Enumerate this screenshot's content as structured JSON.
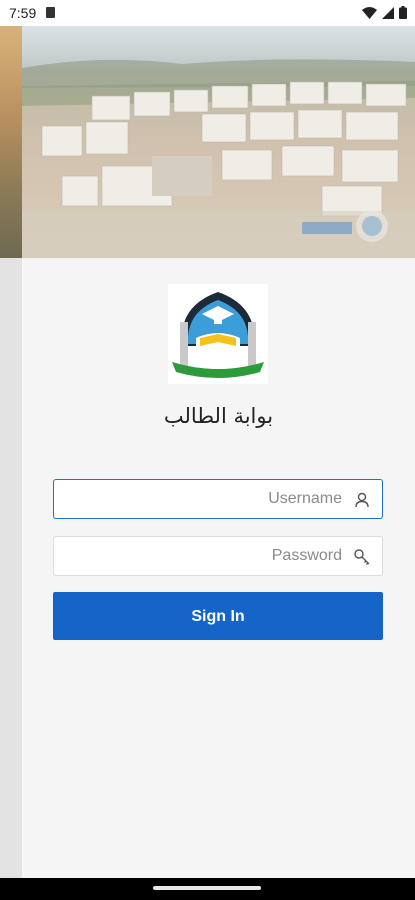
{
  "status_bar": {
    "time": "7:59",
    "icons": [
      "sd-card-icon",
      "wifi-icon",
      "signal-icon",
      "battery-icon"
    ]
  },
  "header": {
    "image": "campus-aerial-photo"
  },
  "logo": {
    "icon": "university-emblem"
  },
  "portal_title": "بوابة الطالب",
  "form": {
    "username_placeholder": "Username",
    "password_placeholder": "Password",
    "signin_label": "Sign In",
    "username_icon": "user-icon",
    "password_icon": "key-icon"
  },
  "colors": {
    "primary": "#1565c8",
    "focus_border": "#1e6fd0",
    "background": "#f5f5f5"
  }
}
